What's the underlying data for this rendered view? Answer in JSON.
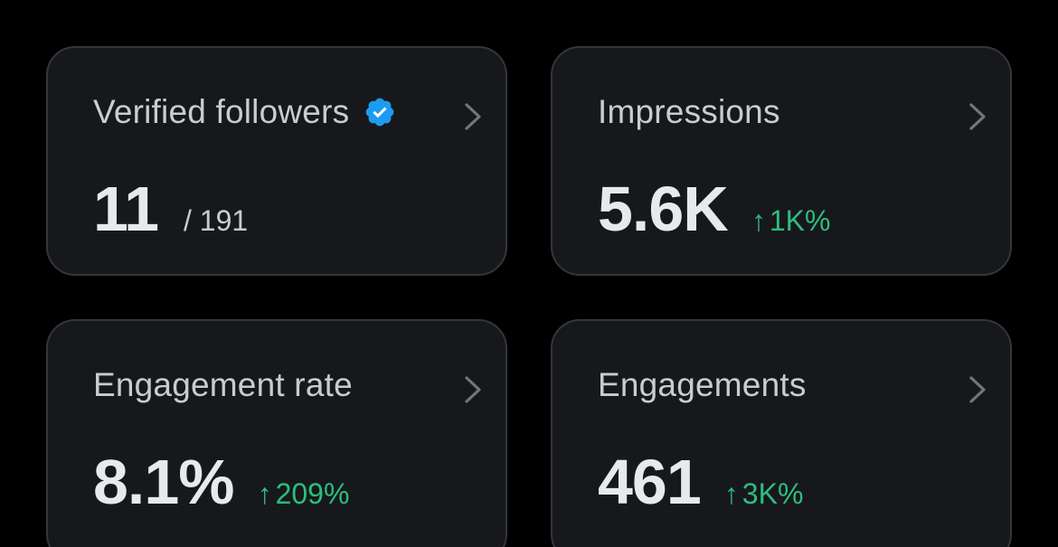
{
  "colors": {
    "background": "#000000",
    "card_bg": "#16181c",
    "card_border": "#33363b",
    "positive": "#2ebd7f",
    "verified": "#1d9bf0"
  },
  "cards": [
    {
      "title": "Verified followers",
      "value": "11",
      "total": "/ 191",
      "icon": "verified-badge-icon"
    },
    {
      "title": "Impressions",
      "value": "5.6K",
      "delta_arrow": "↑",
      "delta": "1K%"
    },
    {
      "title": "Engagement rate",
      "value": "8.1%",
      "delta_arrow": "↑",
      "delta": "209%"
    },
    {
      "title": "Engagements",
      "value": "461",
      "delta_arrow": "↑",
      "delta": "3K%"
    }
  ]
}
